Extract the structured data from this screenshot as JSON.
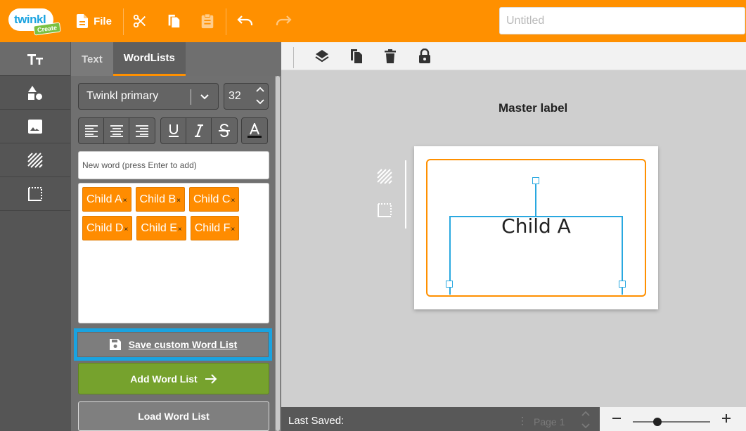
{
  "topbar": {
    "logo_text": "twinkl",
    "logo_badge": "Create",
    "file_label": "File",
    "title_placeholder": "Untitled"
  },
  "panel": {
    "tabs": [
      {
        "label": "Text",
        "active": false
      },
      {
        "label": "WordLists",
        "active": true
      }
    ],
    "font_family": "Twinkl primary",
    "font_size": "32",
    "new_word_placeholder": "New word (press Enter to add)",
    "words": [
      "Child A",
      "Child B",
      "Child C",
      "Child D",
      "Child E",
      "Child F"
    ],
    "chip_remove_symbol": "×",
    "save_label": "Save custom Word List",
    "add_label": "Add Word List",
    "load_label": "Load Word List"
  },
  "canvas": {
    "master_label": "Master label",
    "label_text": "Child A"
  },
  "status": {
    "last_saved": "Last Saved:",
    "page_label": "Page 1"
  },
  "zoom": {
    "level": 0.32
  },
  "colors": {
    "brand_orange": "#ff9000",
    "chip_orange": "#ff8c00",
    "add_green": "#76a22d",
    "selection_blue": "#29a8e0",
    "highlight_blue": "#1aa3e0"
  }
}
